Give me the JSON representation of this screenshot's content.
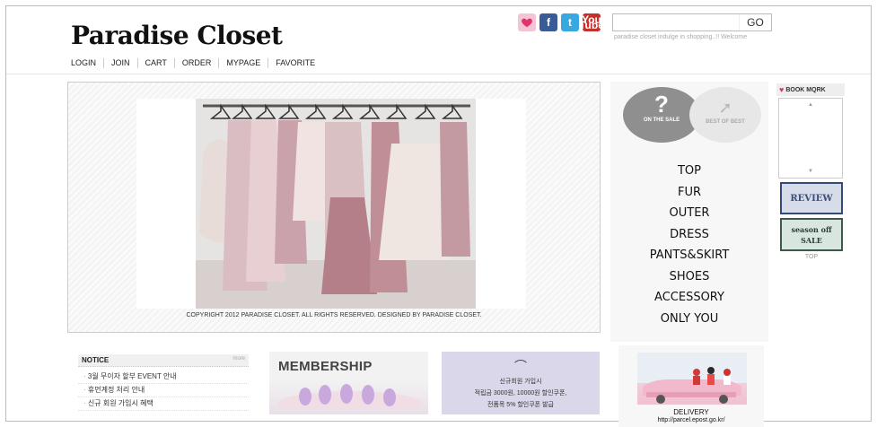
{
  "header": {
    "logo": "Paradise Closet",
    "nav": [
      "LOGIN",
      "JOIN",
      "CART",
      "ORDER",
      "MYPAGE",
      "FAVORITE"
    ],
    "search_button": "GO",
    "search_value": "",
    "tagline": "paradise closet indulge in shopping..!! Welcome",
    "social": [
      "heart-icon",
      "facebook-icon",
      "twitter-icon",
      "youtube-icon"
    ],
    "youtube_label": "You Tube"
  },
  "banner": {
    "copyright": "COPYRIGHT 2012 PARADISE CLOSET. ALL RIGHTS RESERVED. DESIGNED BY PARADISE CLOSET."
  },
  "side": {
    "on_the_sale": "ON THE SALE",
    "best_of_best": "BEST OF BEST",
    "categories": [
      "TOP",
      "FUR",
      "OUTER",
      "DRESS",
      "PANTS&SKIRT",
      "SHOES",
      "ACCESSORY",
      "ONLY YOU"
    ]
  },
  "right": {
    "bookmark": "BOOK MQRK",
    "review": "REVIEW",
    "season_off_1": "season off",
    "season_off_2": "SALE",
    "top": "TOP"
  },
  "notice": {
    "title": "NOTICE",
    "more": "more",
    "items": [
      "3월 무이자 할부 EVENT 안내",
      "휴먼계정 처리 안내",
      "신규 회원 가입시 혜택"
    ]
  },
  "membership": {
    "title": "MEMBERSHIP"
  },
  "signup": {
    "line1": "신규회원 가입시",
    "line2": "적립금 3000원, 10000원 할인쿠폰,",
    "line3": "전품목 5% 할인쿠폰 발급"
  },
  "delivery": {
    "title": "DELIVERY",
    "url": "http://parcel.epost.go.kr/"
  },
  "colors": {
    "signup_bg": "#d9d7e9",
    "review_border": "#334a7a",
    "sale_border": "#3b5a4a",
    "circle_sale": "#8f8f8f"
  }
}
